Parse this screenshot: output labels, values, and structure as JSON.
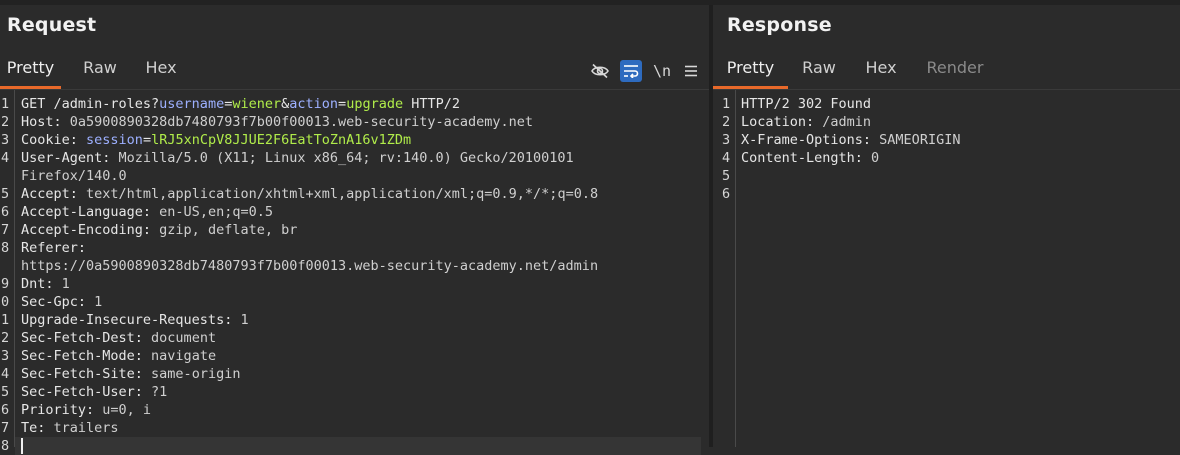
{
  "request": {
    "title": "Request",
    "tabs": [
      "Pretty",
      "Raw",
      "Hex"
    ],
    "active_tab": "Pretty",
    "tools": {
      "hide_icon": "eye-slash-icon",
      "wrap_icon": "wrap-icon",
      "newline_label": "\\n",
      "menu_icon": "hamburger-menu-icon"
    },
    "lines": [
      {
        "n": "1",
        "segs": [
          [
            "k",
            "GET /admin-roles?"
          ],
          [
            "pk",
            "username"
          ],
          [
            "k",
            "="
          ],
          [
            "pv",
            "wiener"
          ],
          [
            "k",
            "&"
          ],
          [
            "pk",
            "action"
          ],
          [
            "k",
            "="
          ],
          [
            "pv",
            "upgrade"
          ],
          [
            "k",
            " HTTP/2"
          ]
        ]
      },
      {
        "n": "2",
        "segs": [
          [
            "k",
            "Host:"
          ],
          [
            "v",
            " 0a5900890328db7480793f7b00f00013.web-security-academy.net"
          ]
        ]
      },
      {
        "n": "3",
        "segs": [
          [
            "k",
            "Cookie:"
          ],
          [
            "pk",
            " session"
          ],
          [
            "k",
            "="
          ],
          [
            "pv",
            "lRJ5xnCpV8JJUE2F6EatToZnA16v1ZDm"
          ]
        ]
      },
      {
        "n": "4",
        "segs": [
          [
            "k",
            "User-Agent:"
          ],
          [
            "v",
            " Mozilla/5.0 (X11; Linux x86_64; rv:140.0) Gecko/20100101"
          ]
        ]
      },
      {
        "n": "",
        "segs": [
          [
            "v",
            "Firefox/140.0"
          ]
        ]
      },
      {
        "n": "5",
        "segs": [
          [
            "k",
            "Accept:"
          ],
          [
            "v",
            " text/html,application/xhtml+xml,application/xml;q=0.9,*/*;q=0.8"
          ]
        ]
      },
      {
        "n": "6",
        "segs": [
          [
            "k",
            "Accept-Language:"
          ],
          [
            "v",
            " en-US,en;q=0.5"
          ]
        ]
      },
      {
        "n": "7",
        "segs": [
          [
            "k",
            "Accept-Encoding:"
          ],
          [
            "v",
            " gzip, deflate, br"
          ]
        ]
      },
      {
        "n": "8",
        "segs": [
          [
            "k",
            "Referer:"
          ]
        ]
      },
      {
        "n": "",
        "segs": [
          [
            "v",
            "https://0a5900890328db7480793f7b00f00013.web-security-academy.net/admin"
          ]
        ]
      },
      {
        "n": "9",
        "segs": [
          [
            "k",
            "Dnt:"
          ],
          [
            "v",
            " 1"
          ]
        ]
      },
      {
        "n": "0",
        "segs": [
          [
            "k",
            "Sec-Gpc:"
          ],
          [
            "v",
            " 1"
          ]
        ]
      },
      {
        "n": "1",
        "segs": [
          [
            "k",
            "Upgrade-Insecure-Requests:"
          ],
          [
            "v",
            " 1"
          ]
        ]
      },
      {
        "n": "2",
        "segs": [
          [
            "k",
            "Sec-Fetch-Dest:"
          ],
          [
            "v",
            " document"
          ]
        ]
      },
      {
        "n": "3",
        "segs": [
          [
            "k",
            "Sec-Fetch-Mode:"
          ],
          [
            "v",
            " navigate"
          ]
        ]
      },
      {
        "n": "4",
        "segs": [
          [
            "k",
            "Sec-Fetch-Site:"
          ],
          [
            "v",
            " same-origin"
          ]
        ]
      },
      {
        "n": "5",
        "segs": [
          [
            "k",
            "Sec-Fetch-User:"
          ],
          [
            "v",
            " ?1"
          ]
        ]
      },
      {
        "n": "6",
        "segs": [
          [
            "k",
            "Priority:"
          ],
          [
            "v",
            " u=0, i"
          ]
        ]
      },
      {
        "n": "7",
        "segs": [
          [
            "k",
            "Te:"
          ],
          [
            "v",
            " trailers"
          ]
        ]
      },
      {
        "n": "8",
        "segs": []
      }
    ]
  },
  "response": {
    "title": "Response",
    "tabs": [
      "Pretty",
      "Raw",
      "Hex",
      "Render"
    ],
    "active_tab": "Pretty",
    "lines": [
      {
        "n": "1",
        "segs": [
          [
            "k",
            "HTTP/2 302 Found"
          ]
        ]
      },
      {
        "n": "2",
        "segs": [
          [
            "k",
            "Location:"
          ],
          [
            "v",
            " /admin"
          ]
        ]
      },
      {
        "n": "3",
        "segs": [
          [
            "k",
            "X-Frame-Options:"
          ],
          [
            "v",
            " SAMEORIGIN"
          ]
        ]
      },
      {
        "n": "4",
        "segs": [
          [
            "k",
            "Content-Length:"
          ],
          [
            "v",
            " 0"
          ]
        ]
      },
      {
        "n": "5",
        "segs": []
      },
      {
        "n": "6",
        "segs": []
      }
    ]
  },
  "colors": {
    "accent": "#e8692a",
    "param_name": "#9db0ff",
    "param_value": "#b0ec4a"
  }
}
